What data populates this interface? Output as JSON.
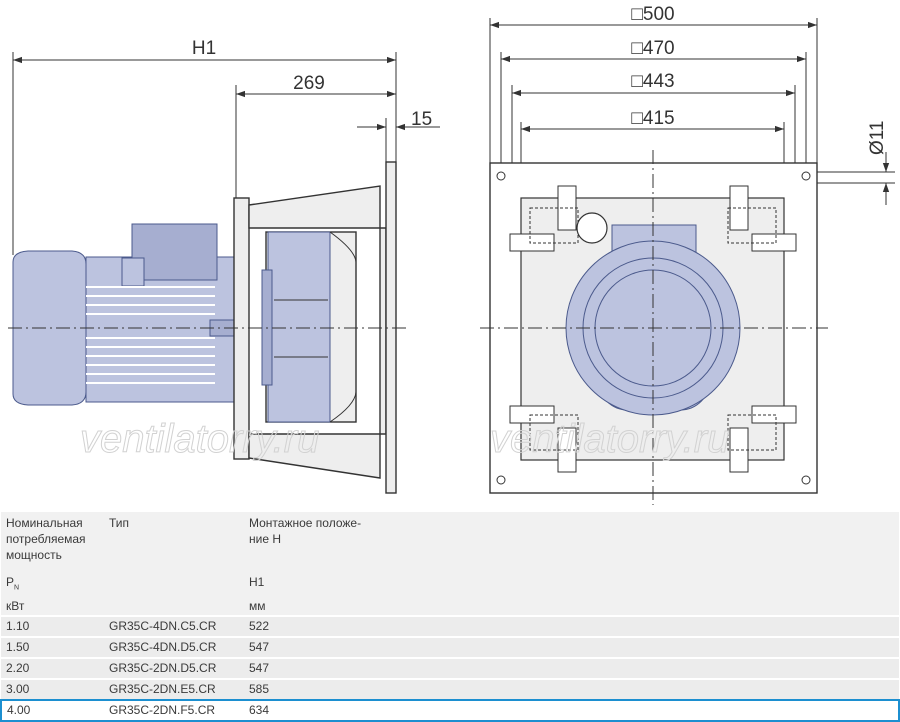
{
  "dimensions": {
    "h1": "H1",
    "len_269": "269",
    "len_15": "15",
    "sq_500": "□500",
    "sq_470": "□470",
    "sq_443": "□443",
    "sq_415": "□415",
    "hole_11": "Ø11"
  },
  "watermark": "ventilatorry.ru",
  "table": {
    "header": {
      "power_label": "Номинальная потребляемая мощность",
      "type_label": "Тип",
      "mount_label": "Монтажное положе-ние H",
      "power_symbol": "P",
      "power_sub": "N",
      "h1_label": "H1",
      "power_unit": "кВт",
      "mm_unit": "мм"
    },
    "rows": [
      {
        "power": "1.10",
        "type": "GR35C-4DN.C5.CR",
        "h1": "522"
      },
      {
        "power": "1.50",
        "type": "GR35C-4DN.D5.CR",
        "h1": "547"
      },
      {
        "power": "2.20",
        "type": "GR35C-2DN.D5.CR",
        "h1": "547"
      },
      {
        "power": "3.00",
        "type": "GR35C-2DN.E5.CR",
        "h1": "585"
      },
      {
        "power": "4.00",
        "type": "GR35C-2DN.F5.CR",
        "h1": "634",
        "highlighted": true
      }
    ]
  },
  "colors": {
    "motor_fill": "#bcc3df",
    "highlight_border": "#1c8fd0"
  }
}
